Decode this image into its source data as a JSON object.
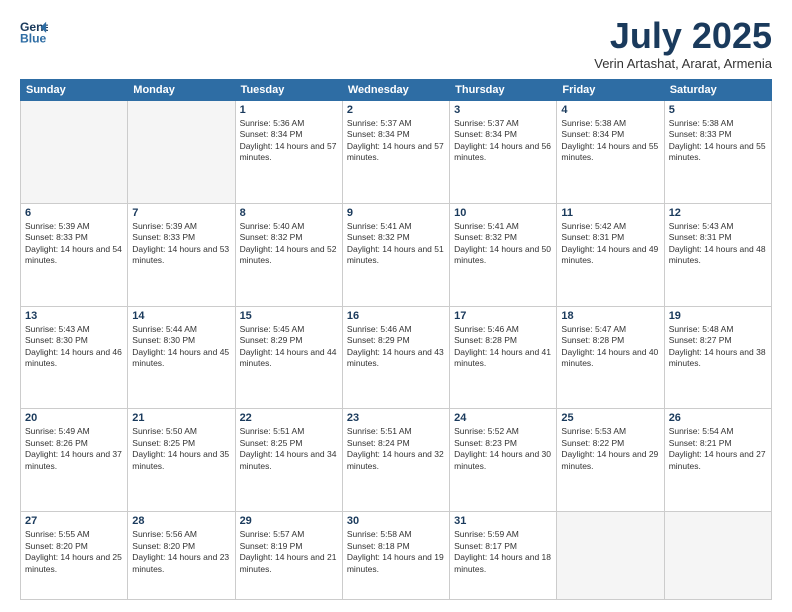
{
  "logo": {
    "line1": "General",
    "line2": "Blue"
  },
  "title": "July 2025",
  "subtitle": "Verin Artashat, Ararat, Armenia",
  "days": [
    "Sunday",
    "Monday",
    "Tuesday",
    "Wednesday",
    "Thursday",
    "Friday",
    "Saturday"
  ],
  "weeks": [
    [
      {
        "day": "",
        "sunrise": "",
        "sunset": "",
        "daylight": ""
      },
      {
        "day": "",
        "sunrise": "",
        "sunset": "",
        "daylight": ""
      },
      {
        "day": "1",
        "sunrise": "Sunrise: 5:36 AM",
        "sunset": "Sunset: 8:34 PM",
        "daylight": "Daylight: 14 hours and 57 minutes."
      },
      {
        "day": "2",
        "sunrise": "Sunrise: 5:37 AM",
        "sunset": "Sunset: 8:34 PM",
        "daylight": "Daylight: 14 hours and 57 minutes."
      },
      {
        "day": "3",
        "sunrise": "Sunrise: 5:37 AM",
        "sunset": "Sunset: 8:34 PM",
        "daylight": "Daylight: 14 hours and 56 minutes."
      },
      {
        "day": "4",
        "sunrise": "Sunrise: 5:38 AM",
        "sunset": "Sunset: 8:34 PM",
        "daylight": "Daylight: 14 hours and 55 minutes."
      },
      {
        "day": "5",
        "sunrise": "Sunrise: 5:38 AM",
        "sunset": "Sunset: 8:33 PM",
        "daylight": "Daylight: 14 hours and 55 minutes."
      }
    ],
    [
      {
        "day": "6",
        "sunrise": "Sunrise: 5:39 AM",
        "sunset": "Sunset: 8:33 PM",
        "daylight": "Daylight: 14 hours and 54 minutes."
      },
      {
        "day": "7",
        "sunrise": "Sunrise: 5:39 AM",
        "sunset": "Sunset: 8:33 PM",
        "daylight": "Daylight: 14 hours and 53 minutes."
      },
      {
        "day": "8",
        "sunrise": "Sunrise: 5:40 AM",
        "sunset": "Sunset: 8:32 PM",
        "daylight": "Daylight: 14 hours and 52 minutes."
      },
      {
        "day": "9",
        "sunrise": "Sunrise: 5:41 AM",
        "sunset": "Sunset: 8:32 PM",
        "daylight": "Daylight: 14 hours and 51 minutes."
      },
      {
        "day": "10",
        "sunrise": "Sunrise: 5:41 AM",
        "sunset": "Sunset: 8:32 PM",
        "daylight": "Daylight: 14 hours and 50 minutes."
      },
      {
        "day": "11",
        "sunrise": "Sunrise: 5:42 AM",
        "sunset": "Sunset: 8:31 PM",
        "daylight": "Daylight: 14 hours and 49 minutes."
      },
      {
        "day": "12",
        "sunrise": "Sunrise: 5:43 AM",
        "sunset": "Sunset: 8:31 PM",
        "daylight": "Daylight: 14 hours and 48 minutes."
      }
    ],
    [
      {
        "day": "13",
        "sunrise": "Sunrise: 5:43 AM",
        "sunset": "Sunset: 8:30 PM",
        "daylight": "Daylight: 14 hours and 46 minutes."
      },
      {
        "day": "14",
        "sunrise": "Sunrise: 5:44 AM",
        "sunset": "Sunset: 8:30 PM",
        "daylight": "Daylight: 14 hours and 45 minutes."
      },
      {
        "day": "15",
        "sunrise": "Sunrise: 5:45 AM",
        "sunset": "Sunset: 8:29 PM",
        "daylight": "Daylight: 14 hours and 44 minutes."
      },
      {
        "day": "16",
        "sunrise": "Sunrise: 5:46 AM",
        "sunset": "Sunset: 8:29 PM",
        "daylight": "Daylight: 14 hours and 43 minutes."
      },
      {
        "day": "17",
        "sunrise": "Sunrise: 5:46 AM",
        "sunset": "Sunset: 8:28 PM",
        "daylight": "Daylight: 14 hours and 41 minutes."
      },
      {
        "day": "18",
        "sunrise": "Sunrise: 5:47 AM",
        "sunset": "Sunset: 8:28 PM",
        "daylight": "Daylight: 14 hours and 40 minutes."
      },
      {
        "day": "19",
        "sunrise": "Sunrise: 5:48 AM",
        "sunset": "Sunset: 8:27 PM",
        "daylight": "Daylight: 14 hours and 38 minutes."
      }
    ],
    [
      {
        "day": "20",
        "sunrise": "Sunrise: 5:49 AM",
        "sunset": "Sunset: 8:26 PM",
        "daylight": "Daylight: 14 hours and 37 minutes."
      },
      {
        "day": "21",
        "sunrise": "Sunrise: 5:50 AM",
        "sunset": "Sunset: 8:25 PM",
        "daylight": "Daylight: 14 hours and 35 minutes."
      },
      {
        "day": "22",
        "sunrise": "Sunrise: 5:51 AM",
        "sunset": "Sunset: 8:25 PM",
        "daylight": "Daylight: 14 hours and 34 minutes."
      },
      {
        "day": "23",
        "sunrise": "Sunrise: 5:51 AM",
        "sunset": "Sunset: 8:24 PM",
        "daylight": "Daylight: 14 hours and 32 minutes."
      },
      {
        "day": "24",
        "sunrise": "Sunrise: 5:52 AM",
        "sunset": "Sunset: 8:23 PM",
        "daylight": "Daylight: 14 hours and 30 minutes."
      },
      {
        "day": "25",
        "sunrise": "Sunrise: 5:53 AM",
        "sunset": "Sunset: 8:22 PM",
        "daylight": "Daylight: 14 hours and 29 minutes."
      },
      {
        "day": "26",
        "sunrise": "Sunrise: 5:54 AM",
        "sunset": "Sunset: 8:21 PM",
        "daylight": "Daylight: 14 hours and 27 minutes."
      }
    ],
    [
      {
        "day": "27",
        "sunrise": "Sunrise: 5:55 AM",
        "sunset": "Sunset: 8:20 PM",
        "daylight": "Daylight: 14 hours and 25 minutes."
      },
      {
        "day": "28",
        "sunrise": "Sunrise: 5:56 AM",
        "sunset": "Sunset: 8:20 PM",
        "daylight": "Daylight: 14 hours and 23 minutes."
      },
      {
        "day": "29",
        "sunrise": "Sunrise: 5:57 AM",
        "sunset": "Sunset: 8:19 PM",
        "daylight": "Daylight: 14 hours and 21 minutes."
      },
      {
        "day": "30",
        "sunrise": "Sunrise: 5:58 AM",
        "sunset": "Sunset: 8:18 PM",
        "daylight": "Daylight: 14 hours and 19 minutes."
      },
      {
        "day": "31",
        "sunrise": "Sunrise: 5:59 AM",
        "sunset": "Sunset: 8:17 PM",
        "daylight": "Daylight: 14 hours and 18 minutes."
      },
      {
        "day": "",
        "sunrise": "",
        "sunset": "",
        "daylight": ""
      },
      {
        "day": "",
        "sunrise": "",
        "sunset": "",
        "daylight": ""
      }
    ]
  ]
}
